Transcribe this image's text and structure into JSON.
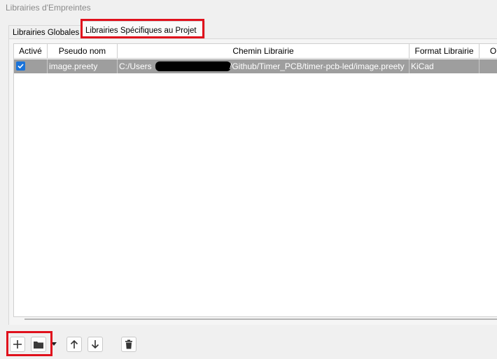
{
  "window": {
    "title": "Librairies d'Empreintes"
  },
  "tabs": [
    {
      "label": "Librairies Globales",
      "active": false
    },
    {
      "label": "Librairies Spécifiques au Projet",
      "active": true
    }
  ],
  "table": {
    "columns": [
      "Activé",
      "Pseudo nom",
      "Chemin Librairie",
      "Format Librairie",
      "O"
    ],
    "rows": [
      {
        "enabled": true,
        "nickname": "image.preety",
        "path_prefix": "C:/Users",
        "path_suffix": "/Github/Timer_PCB/timer-pcb-led/image.preety",
        "format": "KiCad",
        "options": ""
      }
    ]
  },
  "toolbar": {
    "add_icon": "plus-icon",
    "folder_icon": "folder-icon",
    "dropdown_icon": "caret-down-icon",
    "up_icon": "arrow-up-icon",
    "down_icon": "arrow-down-icon",
    "delete_icon": "trash-icon"
  },
  "colors": {
    "highlight": "#e0101c",
    "selected_row": "#9e9e9e",
    "checkbox": "#1a73d9"
  }
}
